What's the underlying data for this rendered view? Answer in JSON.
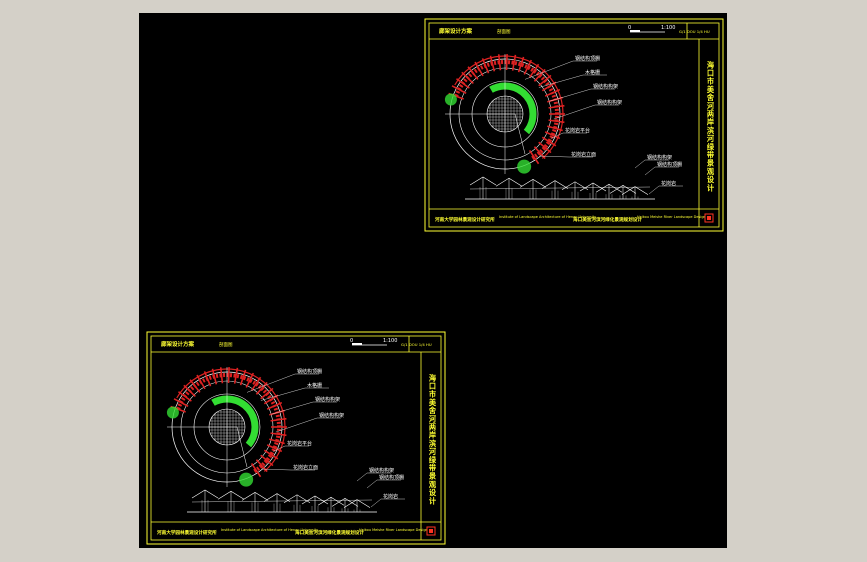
{
  "app": {
    "background_color": "#d4d0c8",
    "viewport_color": "#000000"
  },
  "colors": {
    "frame": "#ffff33",
    "line": "#ffffff",
    "green": "#33dd33",
    "red": "#dd2222",
    "stamp": "#ff3322"
  },
  "sheets": [
    {
      "id": "sheet-top-right",
      "title": "廊架设计方案",
      "subtitle": "剖面图",
      "scale_text": "1:100",
      "sheet_no": "G/1 DOU 1/4 HU",
      "vertical_title": "海口市美舍河两岸滨河绿带景观设计",
      "callouts": [
        "钢结构顶棚",
        "木格栅",
        "钢结构构架",
        "钢结构构架",
        "花岗岩平台",
        "花岗岩立面"
      ],
      "section_callouts": [
        "钢结构构架",
        "钢结构顶棚",
        "花岗岩"
      ],
      "footer": {
        "left": "河南大学园林景观设计研究所",
        "mid_small": "Institute of Landscape Architecture of Henan University",
        "mid": "海口美舍河滨河绿化景观规划设计",
        "right_small": "Haikou Meishe River Landscape Design"
      }
    },
    {
      "id": "sheet-bottom-left",
      "title": "廊架设计方案",
      "subtitle": "剖面图",
      "scale_text": "1:100",
      "sheet_no": "G/1 DOU 1/4 HU",
      "vertical_title": "海口市美舍河两岸滨河绿带景观设计",
      "callouts": [
        "钢结构顶棚",
        "木格栅",
        "钢结构构架",
        "钢结构构架",
        "花岗岩平台",
        "花岗岩立面"
      ],
      "section_callouts": [
        "钢结构构架",
        "钢结构顶棚",
        "花岗岩"
      ],
      "footer": {
        "left": "河南大学园林景观设计研究所",
        "mid_small": "Institute of Landscape Architecture of Henan University",
        "mid": "海口美舍河滨河绿化景观规划设计",
        "right_small": "Haikou Meishe River Landscape Design"
      }
    }
  ]
}
